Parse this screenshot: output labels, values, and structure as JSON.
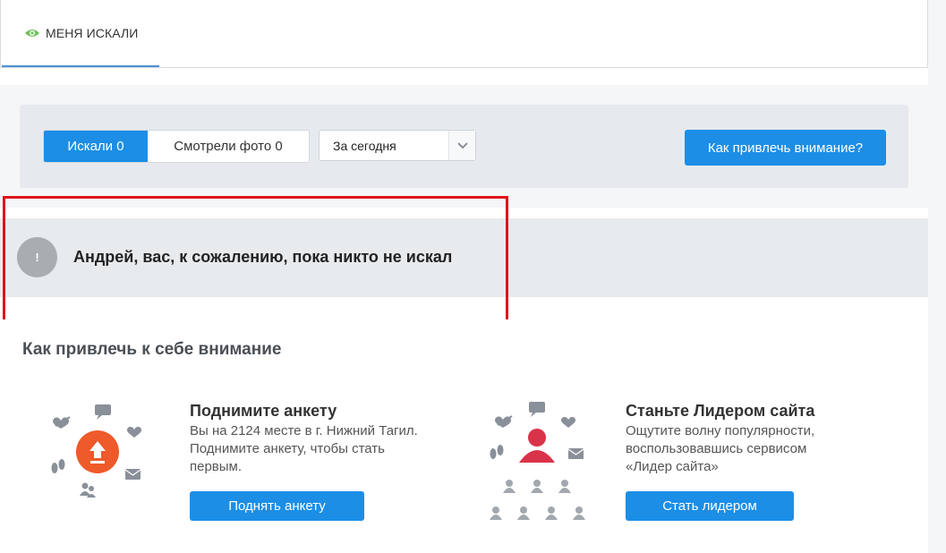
{
  "tabs": {
    "active_label": "МЕНЯ ИСКАЛИ"
  },
  "filter": {
    "segment_active": "Искали 0",
    "segment_inactive": "Смотрели фото 0",
    "period_selected": "За сегодня",
    "attract_button": "Как привлечь внимание?"
  },
  "notice": {
    "icon_text": "!",
    "message": "Андрей, вас, к сожалению, пока никто не искал"
  },
  "section": {
    "title": "Как привлечь к себе внимание",
    "promo1": {
      "title": "Поднимите анкету",
      "text": "Вы на 2124 месте в г. Нижний Тагил. Поднимите анкету, чтобы стать первым.",
      "button": "Поднять анкету"
    },
    "promo2": {
      "title": "Станьте Лидером сайта",
      "text": "Ощутите волну популярности, воспользовавшись сервисом «Лидер сайта»",
      "button": "Стать лидером"
    }
  },
  "colors": {
    "accent": "#1c8ee6",
    "highlight": "#e0141b",
    "promo_orange": "#ee5a2a",
    "leader_red": "#d9334a"
  }
}
